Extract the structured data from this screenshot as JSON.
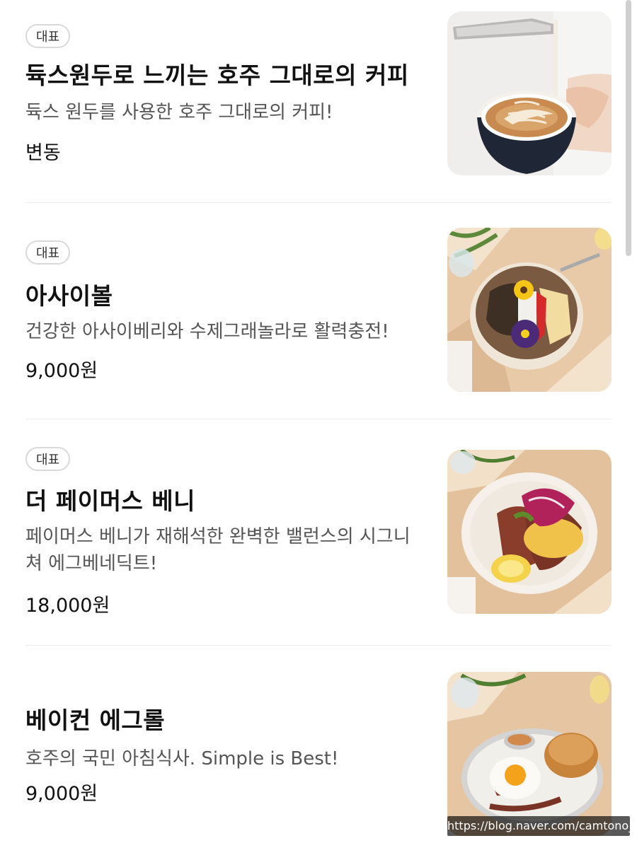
{
  "menu": {
    "items": [
      {
        "badge": "대표",
        "title": "듁스원두로 느끼는 호주 그대로의 커피",
        "description": "듁스 원두를 사용한 호주 그대로의 커피!",
        "price": "변동",
        "image": "latte-art-coffee-cup"
      },
      {
        "badge": "대표",
        "title": "아사이볼",
        "description": "건강한 아사이베리와 수제그래놀라로 활력충전!",
        "price": "9,000원",
        "image": "acai-bowl"
      },
      {
        "badge": "대표",
        "title": "더 페이머스 베니",
        "description": "페이머스 베니가 재해석한 완벽한 밸런스의 시그니쳐 에그베네딕트!",
        "price": "18,000원",
        "image": "eggs-benedict-plate"
      },
      {
        "title": "베이컨 에그롤",
        "description": "호주의 국민 아침식사. Simple is Best!",
        "price": "9,000원",
        "image": "bacon-egg-roll"
      }
    ]
  },
  "watermark": "https://blog.naver.com/camtono_"
}
